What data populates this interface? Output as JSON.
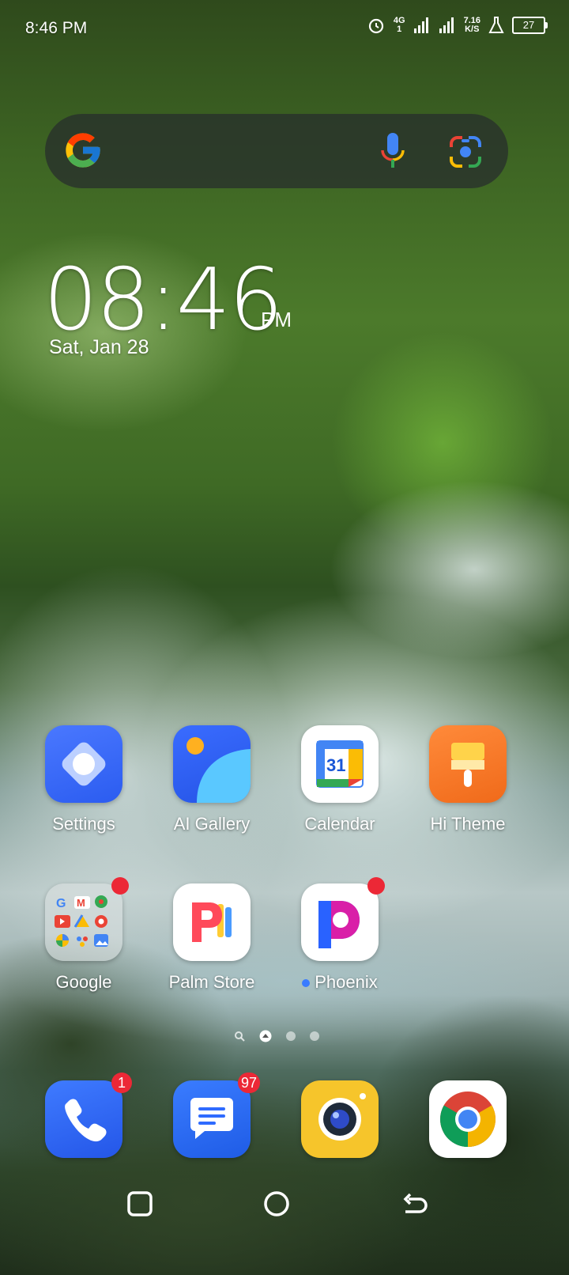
{
  "status_bar": {
    "time": "8:46 PM",
    "network_type": "4G",
    "sim_label": "1",
    "data_speed_value": "7.16",
    "data_speed_unit": "K/S",
    "battery_level": "27",
    "icons": [
      "alarm-icon",
      "signal-icon",
      "signal-icon",
      "flask-icon",
      "battery-icon"
    ]
  },
  "search": {
    "icons": [
      "google-logo-icon",
      "microphone-icon",
      "google-lens-icon"
    ]
  },
  "clock": {
    "time": "08:46",
    "ampm": "PM",
    "date": "Sat, Jan 28"
  },
  "apps": [
    {
      "label": "Settings",
      "icon": "settings-icon"
    },
    {
      "label": "AI Gallery",
      "icon": "gallery-icon"
    },
    {
      "label": "Calendar",
      "icon": "calendar-icon",
      "icon_text": "31"
    },
    {
      "label": "Hi Theme",
      "icon": "theme-brush-icon"
    },
    {
      "label": "Google",
      "icon": "google-folder-icon",
      "has_dot": true
    },
    {
      "label": "Palm Store",
      "icon": "palm-store-icon"
    },
    {
      "label": "Phoenix",
      "icon": "phoenix-icon",
      "has_dot": true,
      "new_indicator": true
    }
  ],
  "dock": [
    {
      "icon": "phone-icon",
      "badge": "1"
    },
    {
      "icon": "messages-icon",
      "badge": "97"
    },
    {
      "icon": "camera-icon"
    },
    {
      "icon": "chrome-icon"
    }
  ],
  "page_indicator": {
    "pages": 3,
    "current": 1,
    "icons": [
      "search-page-icon",
      "home-page-icon"
    ]
  },
  "nav_bar": {
    "icons": [
      "recents-icon",
      "home-icon",
      "back-icon"
    ]
  },
  "colors": {
    "badge": "#ec2836",
    "search_bg": "#282f2c"
  }
}
